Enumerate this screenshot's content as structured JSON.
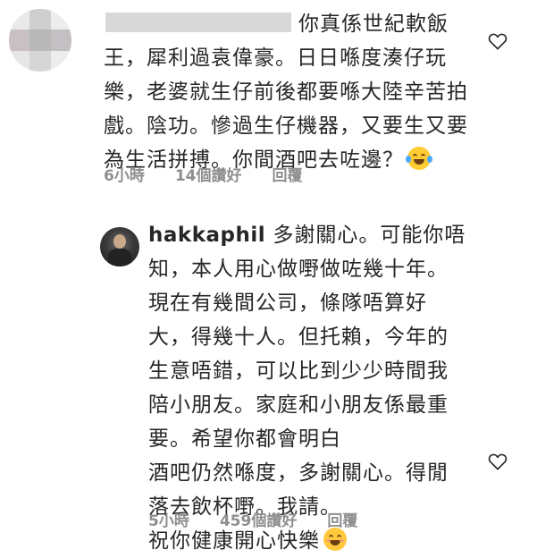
{
  "comments": [
    {
      "username": "",
      "text": "你真係世紀軟飯\n王，犀利過袁偉豪。日日喺度湊仔玩\n樂，老婆就生仔前後都要喺大陸辛苦拍\n戲。陰功。慘過生仔機器，又要生又要\n為生活拼搏。你間酒吧去咗邊？",
      "emoji": "face-with-tears-of-joy",
      "time": "6小時",
      "likes": "14個讚好",
      "reply": "回覆"
    },
    {
      "username": "hakkaphil",
      "text": " 多謝關心。可能你唔\n知，本人用心做嘢做咗幾十年。\n現在有幾間公司，條隊唔算好\n大，得幾十人。但托賴，今年的\n生意唔錯，可以比到少少時間我\n陪小朋友。家庭和小朋友係最重\n要。希望你都會明白\n酒吧仍然喺度，多謝關心。得閒\n落去飲杯嘢。我請。\n祝你健康開心快樂",
      "emoji": "smiling-face",
      "time": "5小時",
      "likes": "459個讚好",
      "reply": "回覆"
    }
  ],
  "colors": {
    "text": "#262626",
    "meta": "#8e8e8e",
    "background": "#ffffff"
  },
  "icons": {
    "like": "heart-outline-icon",
    "avatar_blurred": "blurred-avatar",
    "avatar_user": "user-avatar"
  }
}
